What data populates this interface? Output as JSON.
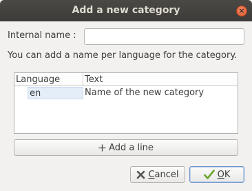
{
  "window": {
    "title": "Add a new category"
  },
  "form": {
    "internal_name_label": "Internal name :",
    "internal_name_value": "",
    "hint": "You can add a name per language for the category."
  },
  "table": {
    "columns": [
      "Language",
      "Text"
    ],
    "rows": [
      {
        "language": "en",
        "text": "Name of the new category"
      }
    ]
  },
  "buttons": {
    "add_line": "Add a line",
    "cancel_mnemonic": "C",
    "cancel_rest": "ancel",
    "ok_mnemonic": "O",
    "ok_rest": "K"
  },
  "icons": {
    "close": "close-icon",
    "add": "plus-icon",
    "cancel": "x-icon",
    "ok": "checkmark-icon"
  }
}
